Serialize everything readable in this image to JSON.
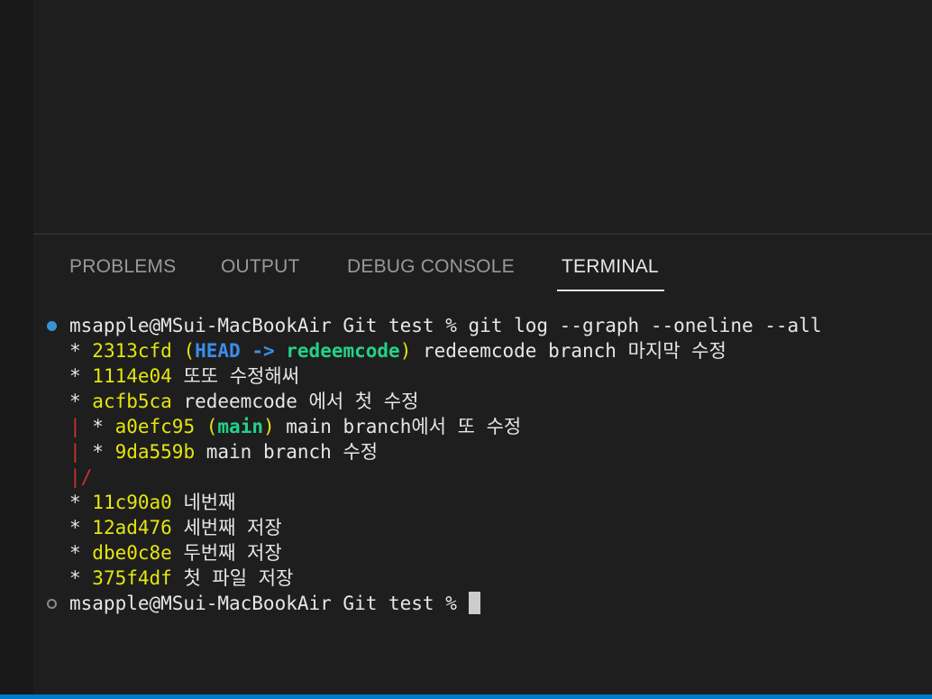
{
  "panel": {
    "tabs": [
      {
        "label": "PROBLEMS",
        "active": false
      },
      {
        "label": "OUTPUT",
        "active": false
      },
      {
        "label": "DEBUG CONSOLE",
        "active": false
      },
      {
        "label": "TERMINAL",
        "active": true
      }
    ]
  },
  "terminal": {
    "prompt": "msapple@MSui-MacBookAir Git test %",
    "command": "git log --graph --oneline --all",
    "log": [
      {
        "graph": "* ",
        "hash": "2313cfd",
        "refs_open": " (",
        "head": "HEAD -> ",
        "branch": "redeemcode",
        "refs_close": ")",
        "message": " redeemcode branch 마지막 수정"
      },
      {
        "graph": "* ",
        "hash": "1114e04",
        "message": " 또또 수정해써"
      },
      {
        "graph": "* ",
        "hash": "acfb5ca",
        "message": " redeemcode 에서 첫 수정"
      },
      {
        "graph_bar": "| ",
        "graph": "* ",
        "hash": "a0efc95",
        "refs_open": " (",
        "branch": "main",
        "refs_close": ")",
        "message": " main branch에서 또 수정"
      },
      {
        "graph_bar": "| ",
        "graph": "* ",
        "hash": "9da559b",
        "message": " main branch 수정"
      },
      {
        "graph_merge": "|/"
      },
      {
        "graph": "* ",
        "hash": "11c90a0",
        "message": " 네번째"
      },
      {
        "graph": "* ",
        "hash": "12ad476",
        "message": " 세번째 저장"
      },
      {
        "graph": "* ",
        "hash": "dbe0c8e",
        "message": " 두번째 저장"
      },
      {
        "graph": "* ",
        "hash": "375f4df",
        "message": " 첫 파일 저장"
      }
    ],
    "prompt_end": "msapple@MSui-MacBookAir Git test %"
  },
  "colors": {
    "hash": "#e5e510",
    "head": "#3b8eea",
    "branch": "#23d18b",
    "graph_branch_line": "#cd3131",
    "prompt_dot_success": "#3794d2",
    "status_bar": "#007acc"
  }
}
